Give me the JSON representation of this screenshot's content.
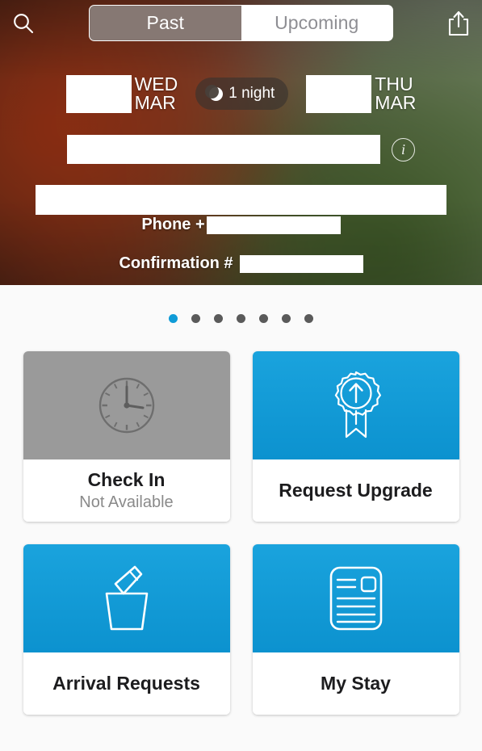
{
  "header": {
    "search_icon": "search-icon",
    "share_icon": "share-icon",
    "segments": [
      {
        "label": "Past",
        "active": true
      },
      {
        "label": "Upcoming",
        "active": false
      }
    ],
    "checkin": {
      "day": "WED",
      "month": "MAR",
      "date_redacted": true
    },
    "checkout": {
      "day": "THU",
      "month": "MAR",
      "date_redacted": true
    },
    "nights_badge": {
      "icon": "moon-icon",
      "label": "1 night"
    },
    "hotel_name_redacted": true,
    "info_icon": "info-icon",
    "address_redacted": true,
    "phone_label": "Phone +",
    "phone_redacted": true,
    "confirmation_label": "Confirmation #",
    "confirmation_redacted": true
  },
  "pager": {
    "count": 7,
    "active_index": 0,
    "active_color": "#0f9bd7",
    "inactive_color": "#5a5a5a"
  },
  "cards": [
    {
      "name": "check-in",
      "title": "Check In",
      "subtitle": "Not Available",
      "icon": "clock-icon",
      "enabled": false,
      "tile_color": "#9a9a9a"
    },
    {
      "name": "request-upgrade",
      "title": "Request Upgrade",
      "subtitle": "",
      "icon": "award-ribbon-up-arrow-icon",
      "enabled": true,
      "tile_color": "#0f9bd7"
    },
    {
      "name": "arrival-requests",
      "title": "Arrival Requests",
      "subtitle": "",
      "icon": "champagne-bucket-icon",
      "enabled": true,
      "tile_color": "#0f9bd7"
    },
    {
      "name": "my-stay",
      "title": "My Stay",
      "subtitle": "",
      "icon": "document-icon",
      "enabled": true,
      "tile_color": "#0f9bd7"
    }
  ]
}
